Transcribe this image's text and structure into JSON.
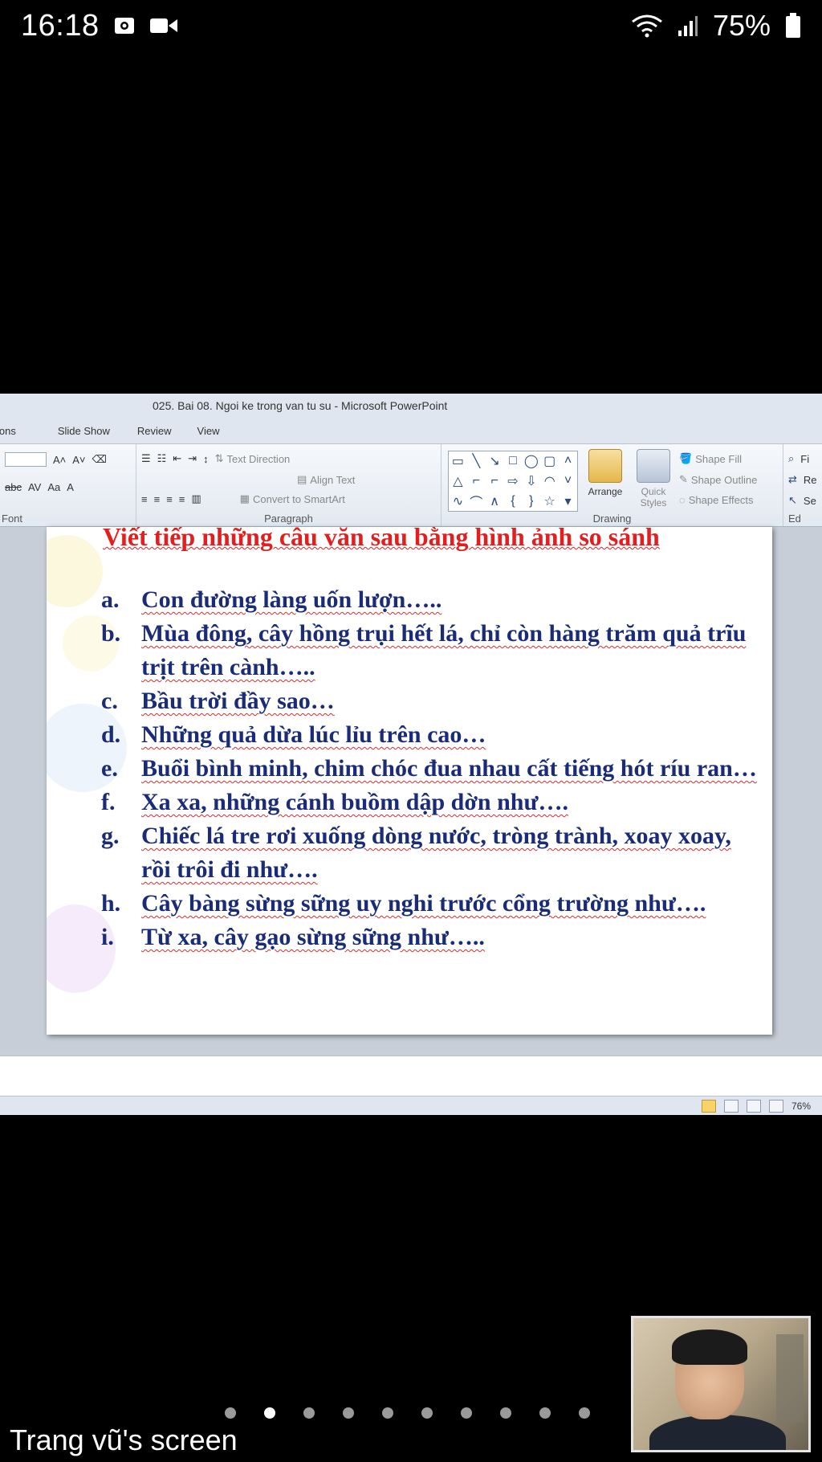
{
  "status_bar": {
    "time": "16:18",
    "battery_percent": "75%",
    "icons": [
      "camera-icon",
      "video-icon",
      "wifi-icon",
      "signal-icon",
      "battery-icon"
    ]
  },
  "powerpoint": {
    "window_title": "025. Bai 08. Ngoi ke trong van tu su  -  Microsoft PowerPoint",
    "tabs": [
      "ions",
      "Slide Show",
      "Review",
      "View"
    ],
    "ribbon": {
      "font_group_label": "Font",
      "paragraph_group_label": "Paragraph",
      "drawing_group_label": "Drawing",
      "editing_group_label": "Ed",
      "text_direction": "Text Direction",
      "align_text": "Align Text",
      "convert_smartart": "Convert to SmartArt",
      "arrange": "Arrange",
      "quick_styles": "Quick Styles",
      "shape_fill": "Shape Fill",
      "shape_outline": "Shape Outline",
      "shape_effects": "Shape Effects",
      "find": "Fi",
      "replace": "Re",
      "select": "Se"
    },
    "zoom": "76%"
  },
  "slide": {
    "title": "Viết tiếp những câu văn sau bằng hình ảnh so sánh",
    "items": [
      {
        "label": "a.",
        "text": "Con đường làng uốn lượn….."
      },
      {
        "label": "b.",
        "text": "Mùa đông, cây hồng trụi hết lá, chỉ còn hàng trăm quả trĩu trịt trên cành….."
      },
      {
        "label": "c.",
        "text": "Bầu trời đầy sao…"
      },
      {
        "label": "d.",
        "text": "Những quả dừa lúc lỉu trên cao…"
      },
      {
        "label": "e.",
        "text": "Buổi bình minh, chim chóc đua nhau cất tiếng hót ríu ran…"
      },
      {
        "label": "f.",
        "text": "Xa xa, những cánh  buồm dập dờn như…."
      },
      {
        "label": "g.",
        "text": "Chiếc lá tre rơi xuống dòng nước, tròng trành, xoay xoay, rồi trôi đi như…."
      },
      {
        "label": "h.",
        "text": "Cây bàng  sừng sững uy nghi trước cổng trường như…."
      },
      {
        "label": "i.",
        "text": "Từ xa, cây gạo sừng sững như….."
      }
    ]
  },
  "meeting": {
    "screen_label": "Trang vũ's screen",
    "page_dots_count": 10,
    "active_dot_index": 1
  },
  "colors": {
    "slide_title": "#e31e1e",
    "slide_text": "#1a2b78",
    "background": "#000000"
  }
}
